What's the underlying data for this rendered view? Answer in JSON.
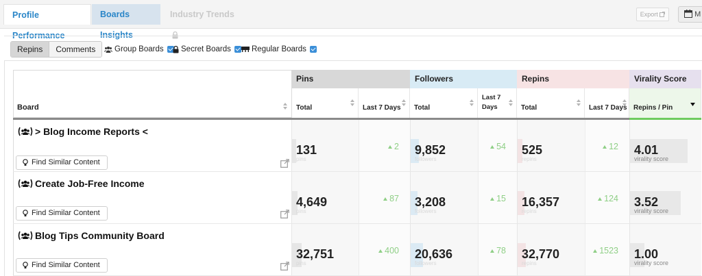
{
  "tabs": [
    {
      "label": "Profile Performance"
    },
    {
      "label": "Boards Insights"
    },
    {
      "label": "Industry Trends"
    }
  ],
  "toolbar": {
    "export_label": "Export",
    "calendar_label": "M"
  },
  "filters": {
    "segment": [
      "Repins",
      "Comments"
    ],
    "group_boards": "Group Boards",
    "secret_boards": "Secret Boards",
    "regular_boards": "Regular Boards"
  },
  "table": {
    "board_header": "Board",
    "groups": {
      "pins": "Pins",
      "followers": "Followers",
      "repins": "Repins",
      "virality": "Virality Score"
    },
    "subheaders": {
      "total": "Total",
      "last7": "Last 7 Days",
      "last7_wrapped_a": "Last 7",
      "last7_wrapped_b": "Days",
      "repins_per_pin": "Repins / Pin"
    },
    "find_similar_label": "Find Similar Content",
    "ghost": {
      "pins": "pins",
      "followers": "followers",
      "repins": "repins"
    },
    "virality_sub": "virality score",
    "rows": [
      {
        "board": "> Blog Income Reports <",
        "pins": "131",
        "pins_delta": "2",
        "followers": "9,852",
        "followers_delta": "54",
        "repins": "525",
        "repins_delta": "12",
        "virality": "4.01"
      },
      {
        "board": "Create Job-Free Income",
        "pins": "4,649",
        "pins_delta": "87",
        "followers": "3,208",
        "followers_delta": "15",
        "repins": "16,357",
        "repins_delta": "124",
        "virality": "3.52"
      },
      {
        "board": "Blog Tips Community Board",
        "pins": "32,751",
        "pins_delta": "400",
        "followers": "20,636",
        "followers_delta": "78",
        "repins": "32,770",
        "repins_delta": "1523",
        "virality": "1.00"
      }
    ]
  },
  "colors": {
    "accent": "#2a86c8",
    "pins_header": "#d8d8d8",
    "followers_header": "#d8ebf5",
    "repins_header": "#f7e3e4",
    "virality_header": "#e6e0ee",
    "delta_green": "#8fcf86"
  }
}
